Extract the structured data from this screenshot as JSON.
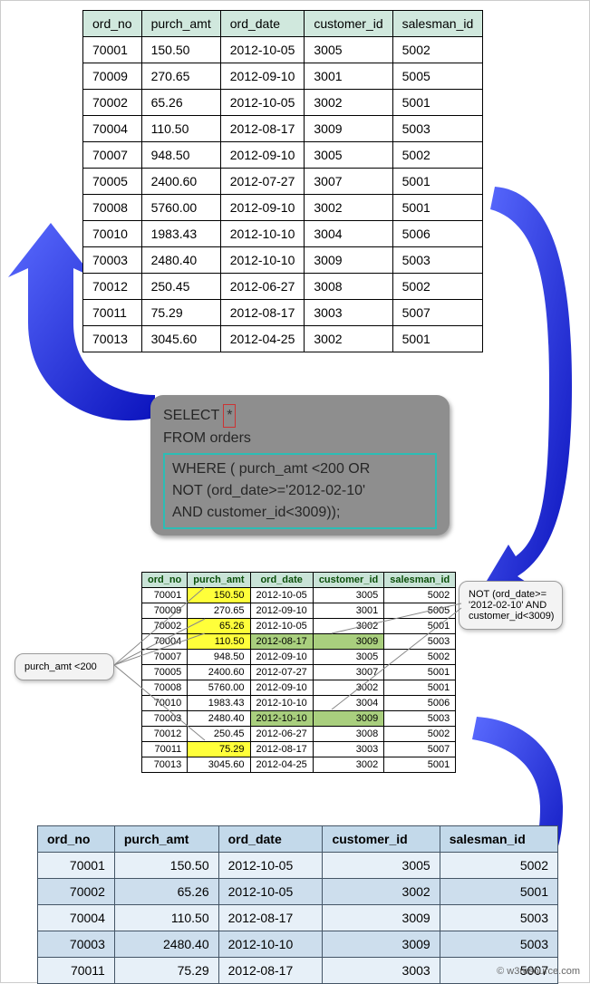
{
  "columns": [
    "ord_no",
    "purch_amt",
    "ord_date",
    "customer_id",
    "salesman_id"
  ],
  "top_rows": [
    [
      "70001",
      "150.50",
      "2012-10-05",
      "3005",
      "5002"
    ],
    [
      "70009",
      "270.65",
      "2012-09-10",
      "3001",
      "5005"
    ],
    [
      "70002",
      "65.26",
      "2012-10-05",
      "3002",
      "5001"
    ],
    [
      "70004",
      "110.50",
      "2012-08-17",
      "3009",
      "5003"
    ],
    [
      "70007",
      "948.50",
      "2012-09-10",
      "3005",
      "5002"
    ],
    [
      "70005",
      "2400.60",
      "2012-07-27",
      "3007",
      "5001"
    ],
    [
      "70008",
      "5760.00",
      "2012-09-10",
      "3002",
      "5001"
    ],
    [
      "70010",
      "1983.43",
      "2012-10-10",
      "3004",
      "5006"
    ],
    [
      "70003",
      "2480.40",
      "2012-10-10",
      "3009",
      "5003"
    ],
    [
      "70012",
      "250.45",
      "2012-06-27",
      "3008",
      "5002"
    ],
    [
      "70011",
      "75.29",
      "2012-08-17",
      "3003",
      "5007"
    ],
    [
      "70013",
      "3045.60",
      "2012-04-25",
      "3002",
      "5001"
    ]
  ],
  "sql": {
    "select": "SELECT",
    "star": "*",
    "from": "FROM  orders",
    "where1": "WHERE ( purch_amt <200   OR",
    "where2": "NOT (ord_date>='2012-02-10'",
    "where3": "AND customer_id<3009));"
  },
  "mid": {
    "rows": [
      {
        "cells": [
          "70001",
          "150.50",
          "2012-10-05",
          "3005",
          "5002"
        ],
        "hl": {
          "1": "y"
        }
      },
      {
        "cells": [
          "70009",
          "270.65",
          "2012-09-10",
          "3001",
          "5005"
        ]
      },
      {
        "cells": [
          "70002",
          "65.26",
          "2012-10-05",
          "3002",
          "5001"
        ],
        "hl": {
          "1": "y"
        }
      },
      {
        "cells": [
          "70004",
          "110.50",
          "2012-08-17",
          "3009",
          "5003"
        ],
        "hl": {
          "1": "y",
          "2": "g",
          "3": "g"
        }
      },
      {
        "cells": [
          "70007",
          "948.50",
          "2012-09-10",
          "3005",
          "5002"
        ]
      },
      {
        "cells": [
          "70005",
          "2400.60",
          "2012-07-27",
          "3007",
          "5001"
        ]
      },
      {
        "cells": [
          "70008",
          "5760.00",
          "2012-09-10",
          "3002",
          "5001"
        ]
      },
      {
        "cells": [
          "70010",
          "1983.43",
          "2012-10-10",
          "3004",
          "5006"
        ]
      },
      {
        "cells": [
          "70003",
          "2480.40",
          "2012-10-10",
          "3009",
          "5003"
        ],
        "hl": {
          "2": "g",
          "3": "g"
        }
      },
      {
        "cells": [
          "70012",
          "250.45",
          "2012-06-27",
          "3008",
          "5002"
        ]
      },
      {
        "cells": [
          "70011",
          "75.29",
          "2012-08-17",
          "3003",
          "5007"
        ],
        "hl": {
          "1": "y"
        }
      },
      {
        "cells": [
          "70013",
          "3045.60",
          "2012-04-25",
          "3002",
          "5001"
        ]
      }
    ]
  },
  "callouts": {
    "left": "purch_amt <200",
    "right": "NOT (ord_date>= '2012-02-10' AND customer_id<3009)"
  },
  "result_rows": [
    [
      "70001",
      "150.50",
      "2012-10-05",
      "3005",
      "5002"
    ],
    [
      "70002",
      "65.26",
      "2012-10-05",
      "3002",
      "5001"
    ],
    [
      "70004",
      "110.50",
      "2012-08-17",
      "3009",
      "5003"
    ],
    [
      "70003",
      "2480.40",
      "2012-10-10",
      "3009",
      "5003"
    ],
    [
      "70011",
      "75.29",
      "2012-08-17",
      "3003",
      "5007"
    ]
  ],
  "footer": "© w3resource.com"
}
